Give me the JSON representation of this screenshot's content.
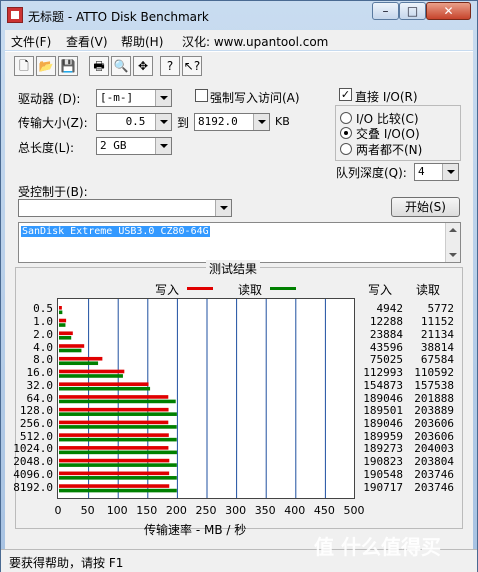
{
  "window": {
    "title": "无标题 - ATTO Disk Benchmark"
  },
  "menu": [
    {
      "label": "文件(F)"
    },
    {
      "label": "查看(V)"
    },
    {
      "label": "帮助(H)"
    },
    {
      "label": "汉化: www.upantool.com"
    }
  ],
  "toolbar": {
    "icons": [
      "new-icon",
      "open-icon",
      "save-icon",
      "print-icon",
      "print-preview-icon",
      "move-icon",
      "help-icon",
      "context-help-icon"
    ]
  },
  "form": {
    "drive_label": "驱动器 (D):",
    "drive_value": "[-m-]",
    "force_write_label": "强制写入访问(A)",
    "transfer_size_label": "传输大小(Z):",
    "transfer_from": "0.5",
    "to_label": "到",
    "transfer_to": "8192.0",
    "unit_kb": "KB",
    "total_length_label": "总长度(L):",
    "total_length_value": "2 GB",
    "direct_io_label": "直接 I/O(R)",
    "io_compare_label": "I/O 比较(C)",
    "overlapped_io_label": "交叠 I/O(O)",
    "neither_label": "两者都不(N)",
    "queue_depth_label": "队列深度(Q):",
    "queue_depth_value": "4",
    "controlled_by_label": "受控制于(B):",
    "controlled_by_value": "",
    "start_button": "开始(S)",
    "description": "SanDisk Extreme USB3.0 CZ80-64G"
  },
  "results": {
    "title": "测试结果",
    "legend_write": "写入",
    "legend_read": "读取",
    "col_write": "写入",
    "col_read": "读取",
    "xlabel": "传输速率 - MB / 秒",
    "xticks": [
      "0",
      "50",
      "100",
      "150",
      "200",
      "250",
      "300",
      "350",
      "400",
      "450",
      "500"
    ]
  },
  "chart_data": {
    "type": "bar",
    "orientation": "horizontal",
    "categories": [
      "0.5",
      "1.0",
      "2.0",
      "4.0",
      "8.0",
      "16.0",
      "32.0",
      "64.0",
      "128.0",
      "256.0",
      "512.0",
      "1024.0",
      "2048.0",
      "4096.0",
      "8192.0"
    ],
    "series": [
      {
        "name": "写入",
        "color": "#e00000",
        "values": [
          4942,
          12288,
          23884,
          43596,
          75025,
          112993,
          154873,
          189046,
          189501,
          189046,
          189959,
          189273,
          190823,
          190548,
          190717
        ]
      },
      {
        "name": "读取",
        "color": "#008000",
        "values": [
          5772,
          11152,
          21134,
          38814,
          67584,
          110592,
          157538,
          201888,
          203889,
          203606,
          203606,
          204003,
          203804,
          203746,
          203746
        ]
      }
    ],
    "value_unit": "KB/s",
    "xlabel": "传输速率 - MB / 秒",
    "xlim": [
      0,
      500
    ],
    "grid": true,
    "legend": "top"
  },
  "status": {
    "text": "要获得帮助，请按 F1"
  },
  "watermark": "值 什么值得买",
  "colors": {
    "write": "#e00000",
    "read": "#008000",
    "selection": "#3399ff"
  }
}
